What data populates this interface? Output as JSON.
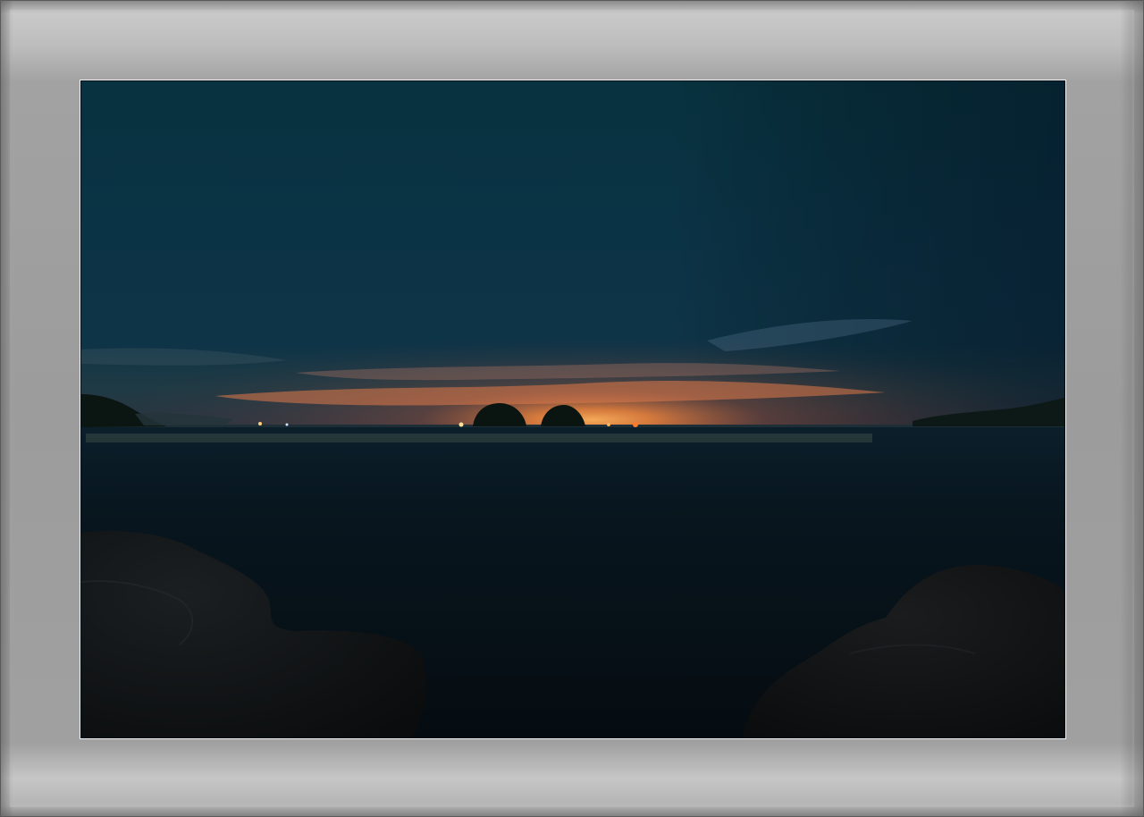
{
  "image": {
    "subject": "night-seascape-photo",
    "colors": {
      "mat": "#9e9e9e",
      "sky_top": "#08323f",
      "glow": "#ff8a3c",
      "sea": "#07141c"
    }
  }
}
